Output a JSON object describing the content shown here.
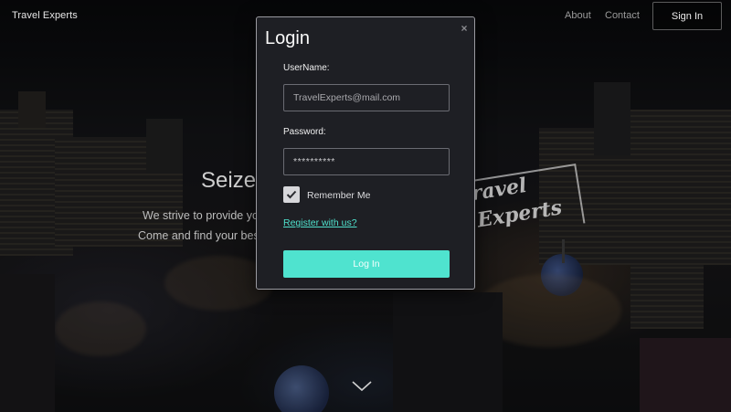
{
  "nav": {
    "brand": "Travel Experts",
    "about": "About",
    "contact": "Contact",
    "sign_in": "Sign In"
  },
  "hero": {
    "title_visible": "Seize",
    "line1_visible": "We strive to provide yo",
    "line2_visible": "Come and find your bes"
  },
  "scene_logo": {
    "line1": "ravel",
    "line2": "Experts"
  },
  "modal": {
    "title": "Login",
    "close_glyph": "×",
    "username_label": "UserName:",
    "username_placeholder": "TravelExperts@mail.com",
    "password_label": "Password:",
    "password_value": "**********",
    "remember_label": "Remember Me",
    "remember_checked": true,
    "register_link": "Register with us?",
    "login_button": "Log In"
  },
  "colors": {
    "accent": "#4fe3cf",
    "link": "#4fe0cc",
    "modal_bg": "#1e1f24"
  },
  "icons": {
    "close": "close-icon",
    "checkbox": "checkmark-icon",
    "scroll": "chevron-down-icon"
  }
}
